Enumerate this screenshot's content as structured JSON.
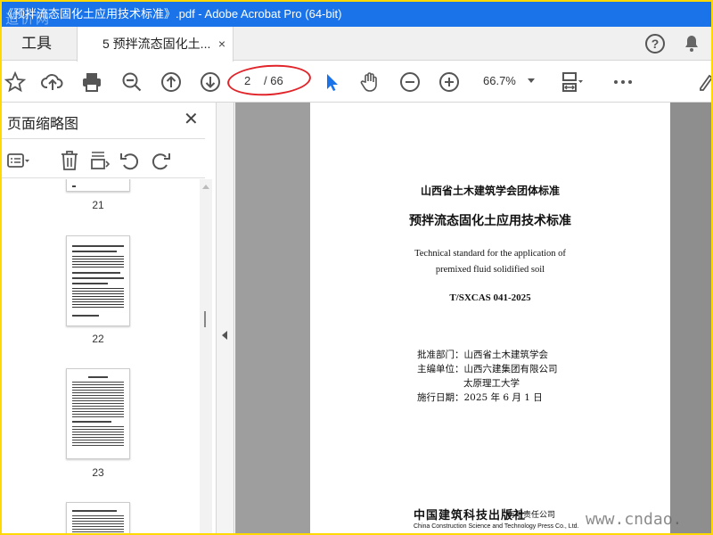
{
  "window": {
    "title": "《预拌流态固化土应用技术标准》.pdf - Adobe Acrobat Pro (64-bit)",
    "watermark_top": "造价网"
  },
  "tabs": {
    "tools_label": "工具",
    "doc_label": "5 预拌流态固化土...",
    "close_glyph": "×"
  },
  "header_icons": {
    "help": "?",
    "bell": "bell-icon"
  },
  "toolbar": {
    "current_page": "2",
    "total_pages": "/ 66",
    "zoom": "66.7%"
  },
  "left_panel": {
    "title": "页面缩略图",
    "close_glyph": "✕",
    "thumbnails": [
      {
        "page": "21"
      },
      {
        "page": "22"
      },
      {
        "page": "23"
      },
      {
        "page": ""
      }
    ]
  },
  "page": {
    "org": "山西省土木建筑学会团体标准",
    "title": "预拌流态固化土应用技术标准",
    "en_line1": "Technical standard for the application of",
    "en_line2": "premixed fluid solidified soil",
    "code": "T/SXCAS 041-2025",
    "approval": "批准部门：山西省土木建筑学会",
    "chief_unit_1": "主编单位：山西六建集团有限公司",
    "chief_unit_2": "太原理工大学",
    "effective": "施行日期：2025 年 6 月 1 日",
    "publisher_cn": "中国建筑科技出版社",
    "publisher_cn2": "有限责任公司",
    "publisher_en": "China Construction Science and Technology Press Co., Ltd."
  },
  "watermark_bottom": "www.cndao.",
  "colors": {
    "titlebar": "#1a73e8",
    "annotation_oval": "#e0242a",
    "border": "#ffd900"
  }
}
